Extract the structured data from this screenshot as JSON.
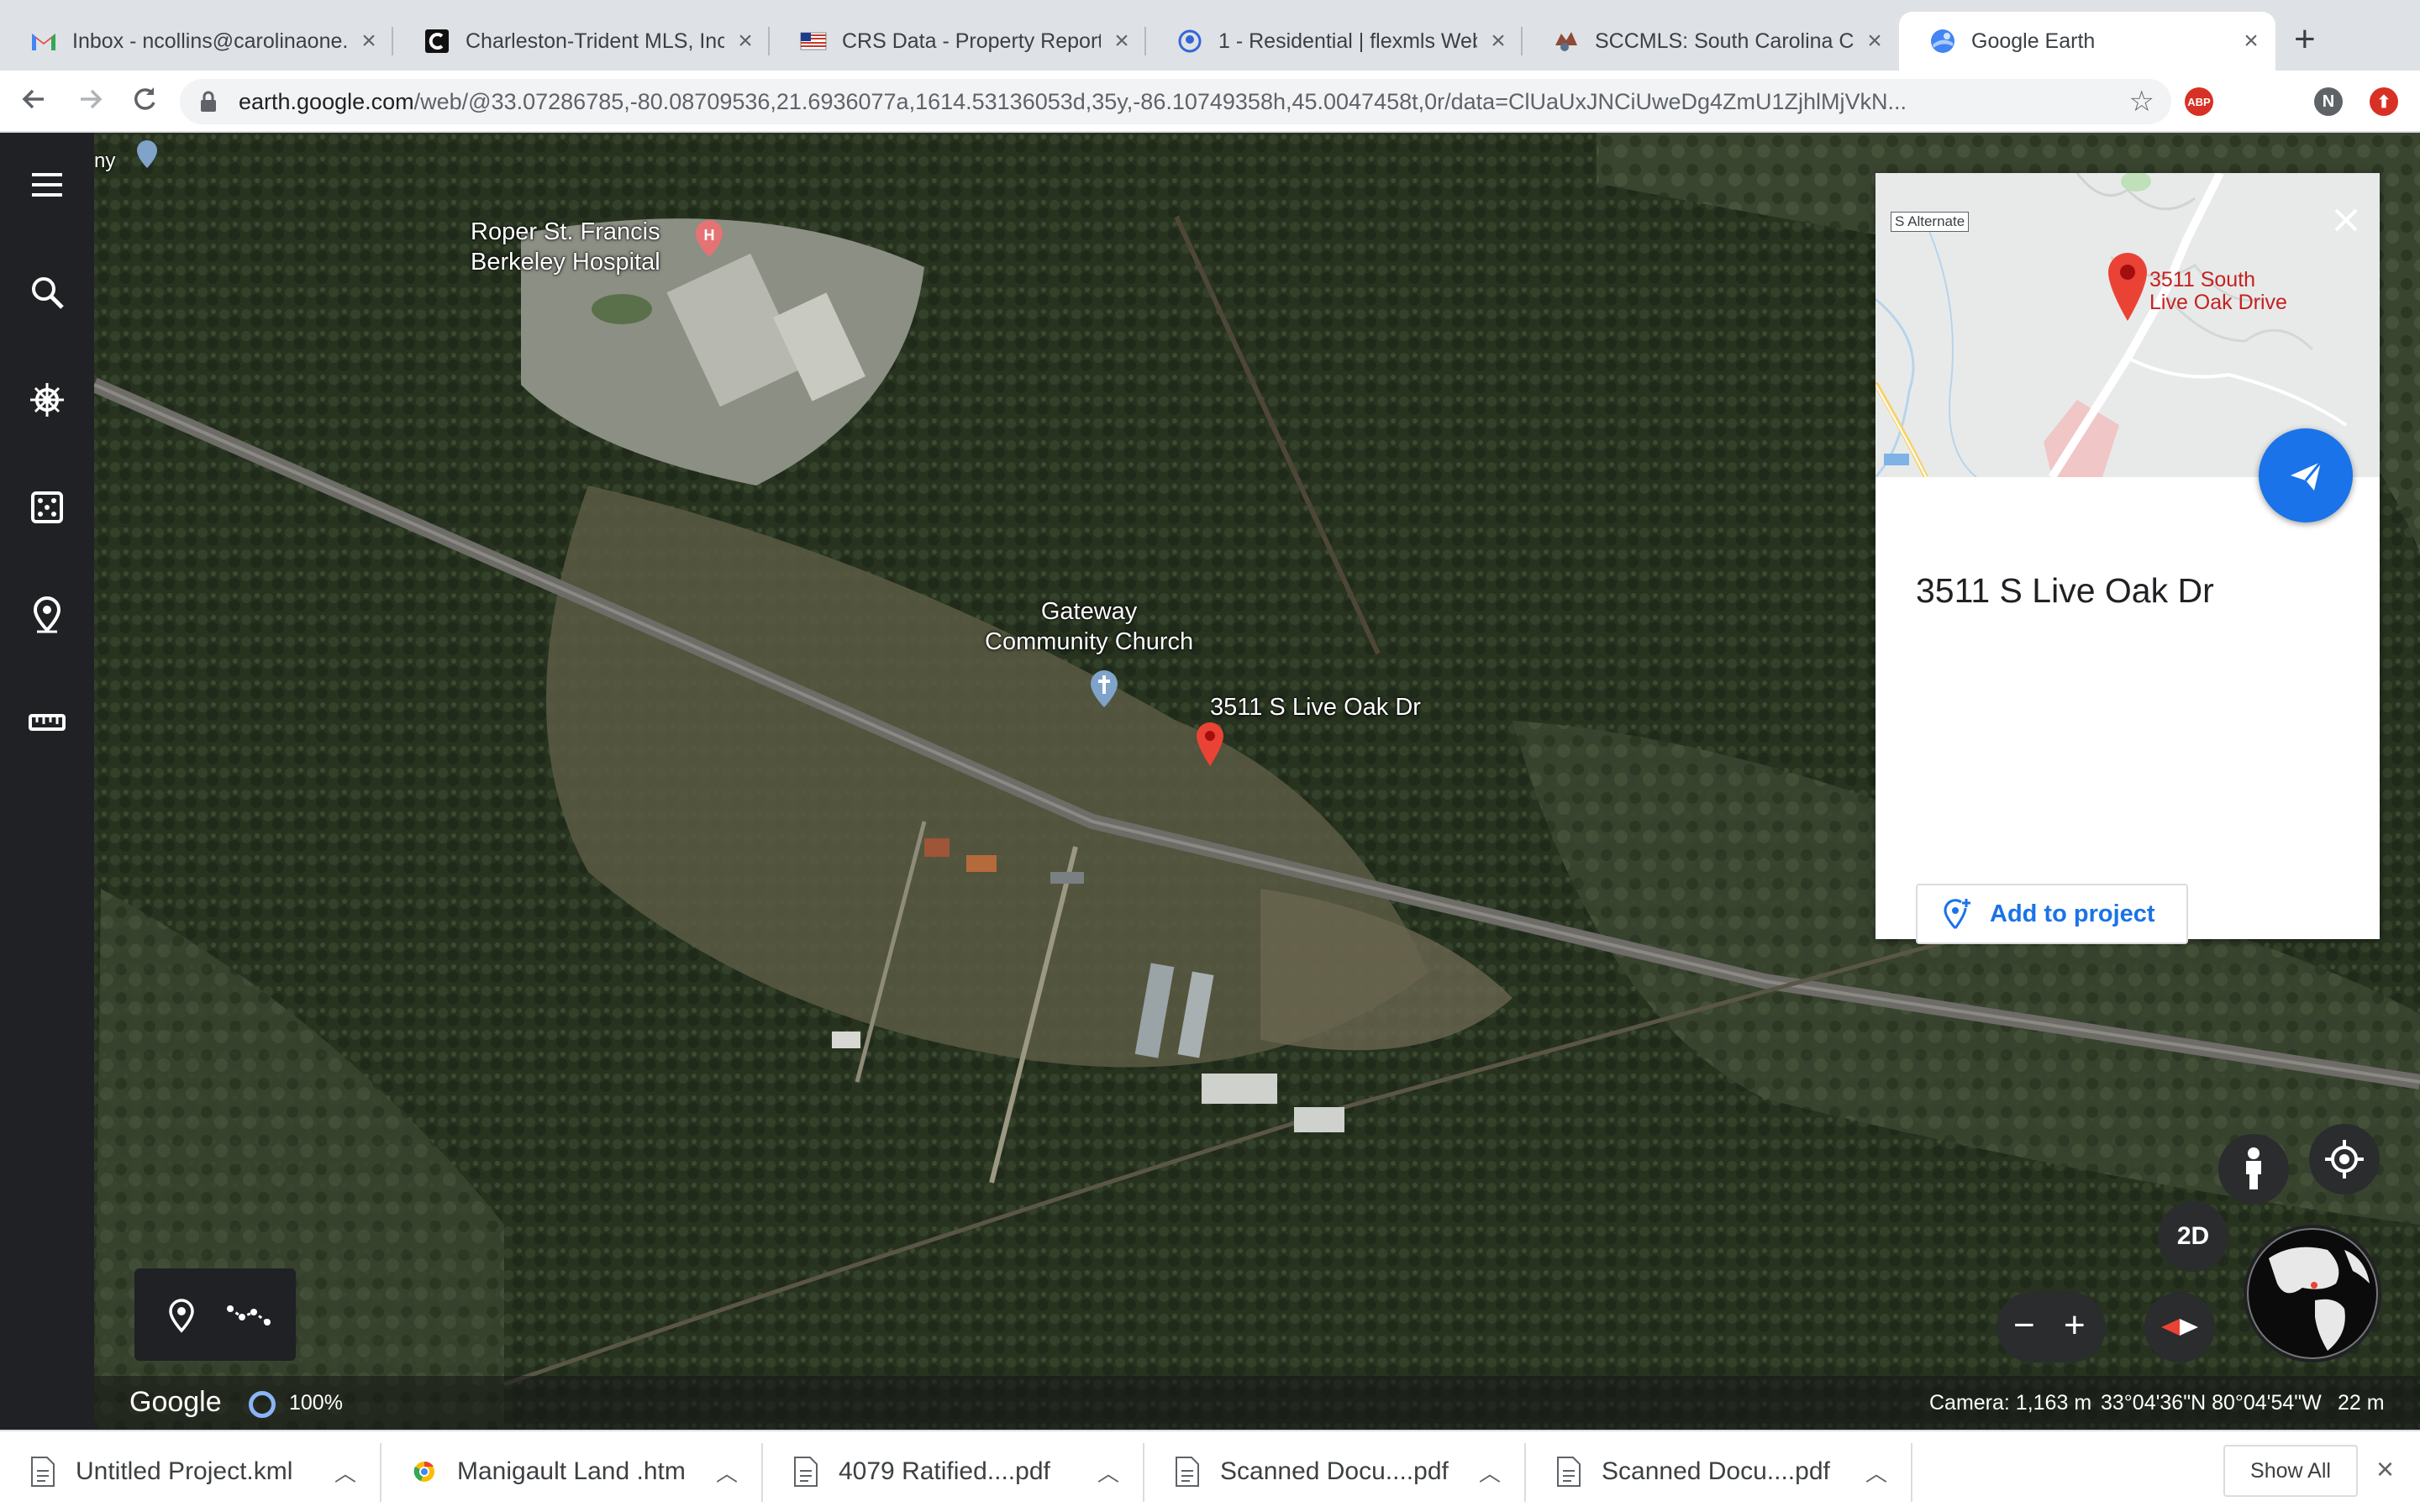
{
  "browser": {
    "tabs": [
      {
        "title": "Inbox - ncollins@carolinaone.",
        "favicon": "gmail-icon"
      },
      {
        "title": "Charleston-Trident MLS, Inc.",
        "favicon": "mls-c-icon"
      },
      {
        "title": "CRS Data - Property Report",
        "favicon": "crs-flag-icon"
      },
      {
        "title": "1 - Residential | flexmls Web",
        "favicon": "flexmls-icon"
      },
      {
        "title": "SCCMLS: South Carolina Co",
        "favicon": "sccmls-icon"
      },
      {
        "title": "Google Earth",
        "favicon": "google-earth-icon",
        "active": true
      }
    ],
    "new_tab_label": "+",
    "url": {
      "host": "earth.google.com",
      "path": "/web/@33.07286785,-80.08709536,21.6936077a,1614.53136053d,35y,-86.10749358h,45.0047458t,0r/data=ClUaUxJNCiUweDg4ZmU1ZjhlMjVkN..."
    },
    "profile_initial": "N",
    "abp_label": "ABP"
  },
  "map": {
    "labels": {
      "hospital": "Roper St. Francis\nBerkeley Hospital",
      "church": "Gateway\nCommunity Church",
      "pin": "3511 S Live Oak Dr",
      "edge_left": "ny"
    }
  },
  "card": {
    "minimap_road_label": "S Alternate",
    "minimap_pin_label": "3511 South\nLive Oak Drive",
    "title": "3511 S Live Oak Dr",
    "add_to_project": "Add to project"
  },
  "controls": {
    "view_mode": "2D",
    "zoom_out": "−",
    "zoom_in": "+"
  },
  "status": {
    "brand": "Google",
    "loading_percent": "100%",
    "camera": "Camera: 1,163 m",
    "coords": "33°04'36\"N 80°04'54\"W",
    "scale": "22 m"
  },
  "downloads": {
    "items": [
      {
        "name": "Untitled Project.kml"
      },
      {
        "name": "Manigault Land .htm"
      },
      {
        "name": "4079  Ratified....pdf"
      },
      {
        "name": "Scanned Docu....pdf"
      },
      {
        "name": "Scanned Docu....pdf"
      }
    ],
    "show_all": "Show All"
  }
}
